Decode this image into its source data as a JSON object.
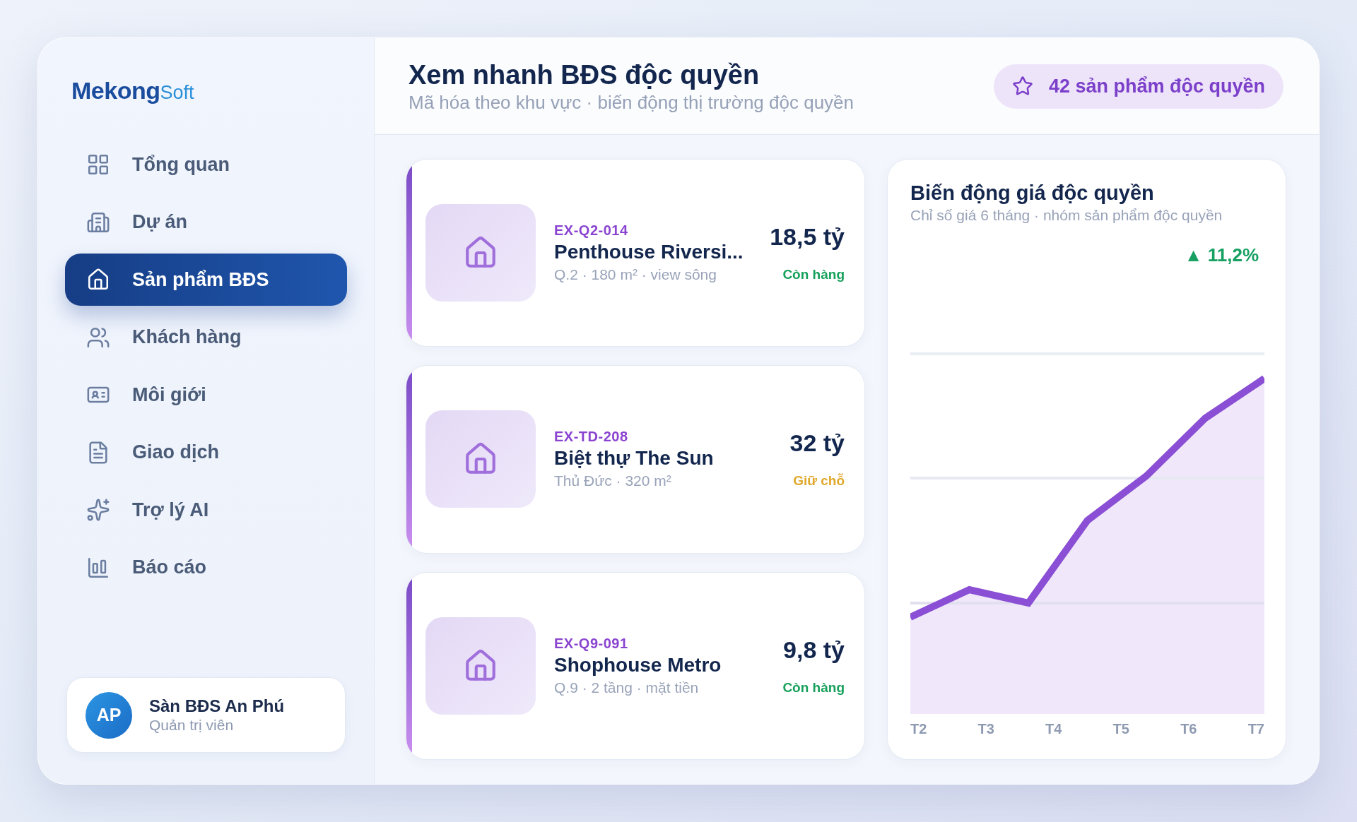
{
  "sidebar": {
    "logo": {
      "primary": "Mekong",
      "secondary": "Soft"
    },
    "items": [
      {
        "label": "Tổng quan",
        "selected": false
      },
      {
        "label": "Dự án",
        "selected": false
      },
      {
        "label": "Sản phẩm BĐS",
        "selected": true
      },
      {
        "label": "Khách hàng",
        "selected": false
      },
      {
        "label": "Môi giới",
        "selected": false
      },
      {
        "label": "Giao dịch",
        "selected": false
      },
      {
        "label": "Trợ lý AI",
        "selected": false
      },
      {
        "label": "Báo cáo",
        "selected": false
      }
    ],
    "user": {
      "initials": "AP",
      "name": "Sàn BĐS An Phú",
      "role": "Quản trị viên"
    }
  },
  "header": {
    "title": "Xem nhanh BĐS độc quyền",
    "subtitle": "Mã hóa theo khu vực · biến động thị trường độc quyền",
    "badge": "42 sản phẩm độc quyền"
  },
  "listings": [
    {
      "code": "EX-Q2-014",
      "title": "Penthouse Riversi...",
      "details": "Q.2 · 180 m² · view sông",
      "price": "18,5 tỷ",
      "status": {
        "label": "Còn hàng",
        "color": "#16a05a"
      }
    },
    {
      "code": "EX-TD-208",
      "title": "Biệt thự The Sun",
      "details": "Thủ Đức · 320 m²",
      "price": "32 tỷ",
      "status": {
        "label": "Giữ chỗ",
        "color": "#e0a82a"
      }
    },
    {
      "code": "EX-Q9-091",
      "title": "Shophouse Metro",
      "details": "Q.9 · 2 tầng · mặt tiền",
      "price": "9,8 tỷ",
      "status": {
        "label": "Còn hàng",
        "color": "#16a05a"
      }
    }
  ],
  "price_chart": {
    "title": "Biến động giá độc quyền",
    "subtitle": "Chỉ số giá 6 tháng · nhóm sản phẩm độc quyền",
    "change": "▲ 11,2%",
    "x_labels": [
      "T2",
      "T3",
      "T4",
      "T5",
      "T6",
      "T7"
    ]
  }
}
